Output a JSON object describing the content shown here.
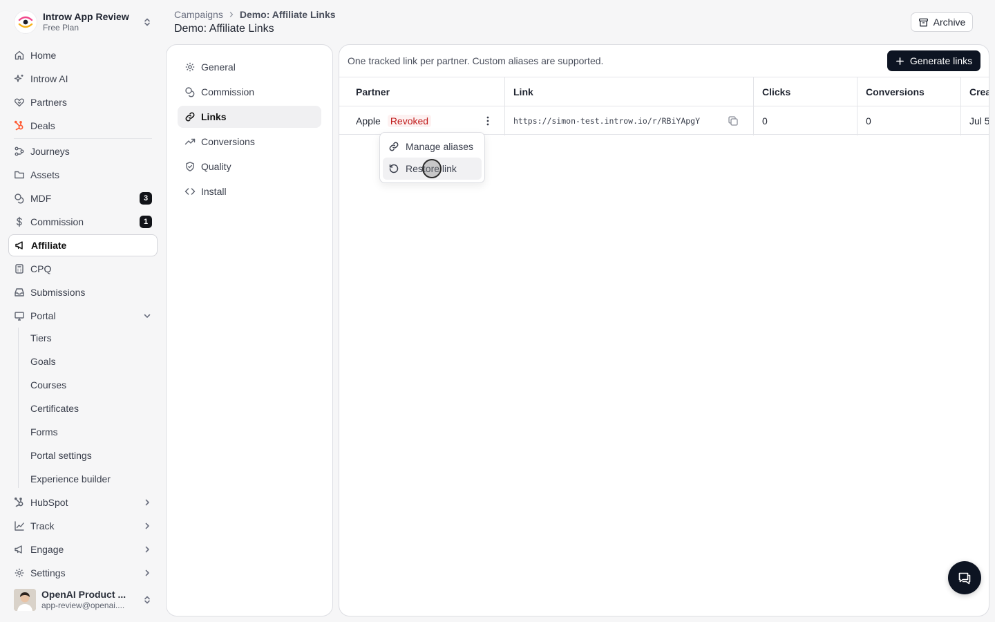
{
  "workspace": {
    "name": "Introw App Review",
    "plan": "Free Plan"
  },
  "sidebar": {
    "items": [
      {
        "label": "Home",
        "icon": "home-icon"
      },
      {
        "label": "Introw AI",
        "icon": "sparkle-icon"
      },
      {
        "label": "Partners",
        "icon": "handshake-icon"
      },
      {
        "label": "Deals",
        "icon": "hubspot-icon"
      },
      {
        "label": "Journeys",
        "icon": "workflow-icon"
      },
      {
        "label": "Assets",
        "icon": "folder-icon"
      },
      {
        "label": "MDF",
        "icon": "coins-icon",
        "badge": "3"
      },
      {
        "label": "Commission",
        "icon": "dollar-icon",
        "badge": "1"
      },
      {
        "label": "Affiliate",
        "icon": "megaphone-icon"
      },
      {
        "label": "CPQ",
        "icon": "calculator-icon"
      },
      {
        "label": "Submissions",
        "icon": "inbox-icon"
      },
      {
        "label": "Portal",
        "icon": "monitor-icon"
      }
    ],
    "portal_sub": [
      "Tiers",
      "Goals",
      "Courses",
      "Certificates",
      "Forms",
      "Portal settings",
      "Experience builder"
    ],
    "bottom_items": [
      {
        "label": "HubSpot",
        "icon": "hubspot-icon"
      },
      {
        "label": "Track",
        "icon": "chart-icon"
      },
      {
        "label": "Engage",
        "icon": "megaphone-icon"
      },
      {
        "label": "Settings",
        "icon": "gear-icon"
      }
    ]
  },
  "user": {
    "name": "OpenAI Product ...",
    "email": "app-review@openai...."
  },
  "header": {
    "breadcrumb_root": "Campaigns",
    "breadcrumb_current": "Demo: Affiliate Links",
    "title": "Demo: Affiliate Links",
    "archive_label": "Archive"
  },
  "settings_nav": [
    {
      "label": "General",
      "icon": "gear-icon"
    },
    {
      "label": "Commission",
      "icon": "coins-icon"
    },
    {
      "label": "Links",
      "icon": "link-icon"
    },
    {
      "label": "Conversions",
      "icon": "trend-icon"
    },
    {
      "label": "Quality",
      "icon": "shield-icon"
    },
    {
      "label": "Install",
      "icon": "code-icon"
    }
  ],
  "main": {
    "description": "One tracked link per partner. Custom aliases are supported.",
    "generate_label": "Generate links",
    "columns": [
      "Partner",
      "Link",
      "Clicks",
      "Conversions",
      "Crea"
    ],
    "rows": [
      {
        "partner": "Apple",
        "status": "Revoked",
        "link": "https://simon-test.introw.io/r/RBiYApgY",
        "clicks": "0",
        "conversions": "0",
        "created": "Jul 5"
      }
    ]
  },
  "menu": {
    "items": [
      {
        "label": "Manage aliases",
        "icon": "link-icon"
      },
      {
        "label": "Restore link",
        "icon": "restore-icon"
      }
    ]
  },
  "colors": {
    "accent_dark": "#0d1422",
    "revoked_red": "#c01c1c",
    "background": "#f6f6f7"
  }
}
